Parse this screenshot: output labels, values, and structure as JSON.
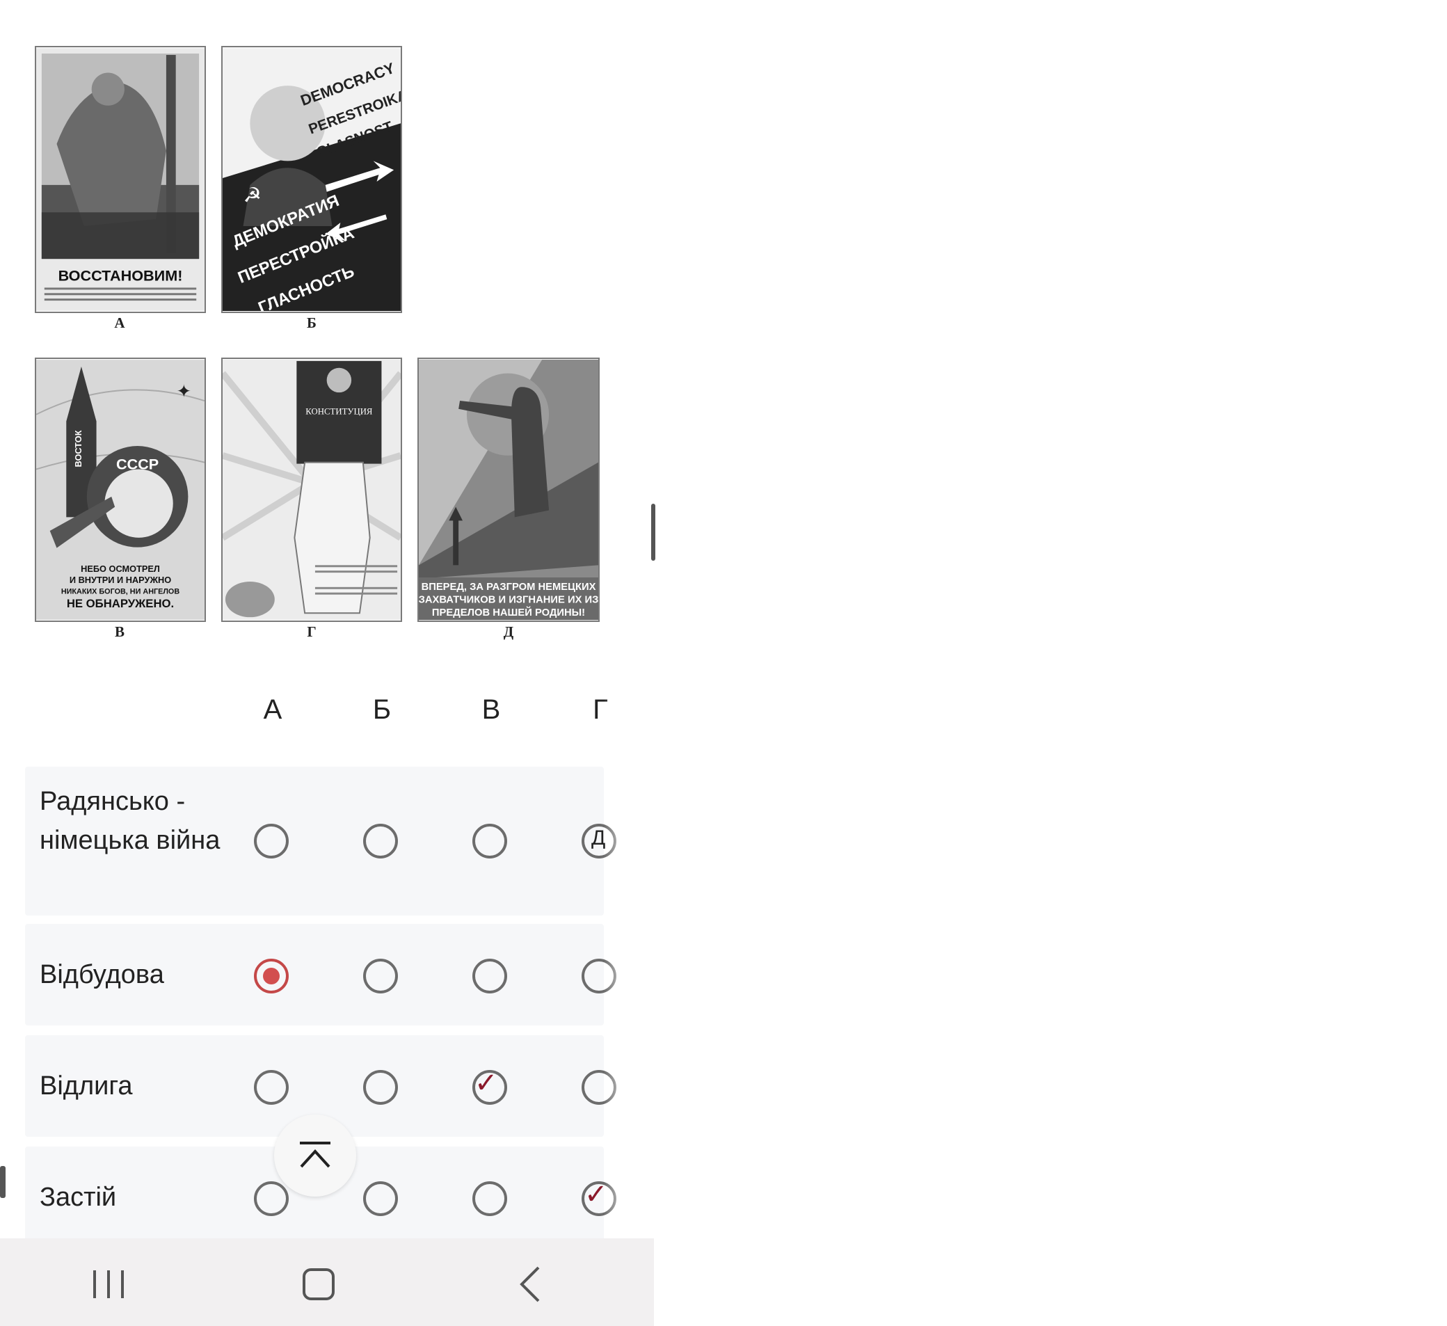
{
  "posters": [
    {
      "id": "A",
      "caption": "А",
      "title_text": "ВОССТАНОВИМ!"
    },
    {
      "id": "B",
      "caption": "Б",
      "text_lines": [
        "DEMOCRACY",
        "PERESTROIKA",
        "GLASNOST",
        "ДЕМОКРАТИЯ",
        "ПЕРЕСТРОЙКА",
        "ГЛАСНОСТЬ"
      ]
    },
    {
      "id": "V",
      "caption": "В",
      "text_lines": [
        "ВОСТОК",
        "СССР",
        "НЕБО ОСМОТРЕЛ",
        "И ВНУТРИ И НАРУЖНО",
        "НИКАКИХ БОГОВ, НИ АНГЕЛОВ",
        "НЕ ОБНАРУЖЕНО."
      ]
    },
    {
      "id": "G",
      "caption": "Г",
      "text_lines": [
        "КОНСТИТУЦИЯ"
      ]
    },
    {
      "id": "D",
      "caption": "Д",
      "text_lines": [
        "ВПЕРЕД, ЗА РАЗГРОМ НЕМЕЦКИХ",
        "ЗАХВАТЧИКОВ И ИЗГНАНИЕ ИХ ИЗ",
        "ПРЕДЕЛОВ НАШЕЙ РОДИНЫ!"
      ]
    }
  ],
  "grid": {
    "columns": [
      "А",
      "Б",
      "В",
      "Г"
    ],
    "rows": [
      {
        "label": "Радянсько - німецька війна",
        "selected": null,
        "handwritten_mark": "Д"
      },
      {
        "label": "Відбудова",
        "selected": "А"
      },
      {
        "label": "Відлига",
        "selected": null,
        "handwritten_mark": "✓",
        "mark_col": "В"
      },
      {
        "label": "Застій",
        "selected": null,
        "handwritten_mark": "✓",
        "mark_col": "Г"
      }
    ]
  },
  "colors": {
    "selected": "#d24f4f",
    "row_bg": "#f6f7f9",
    "navbar_bg": "#f2f0f1",
    "mark": "#8b1a2b"
  },
  "navbar": {
    "icons": [
      "recents-icon",
      "home-icon",
      "back-icon"
    ]
  }
}
